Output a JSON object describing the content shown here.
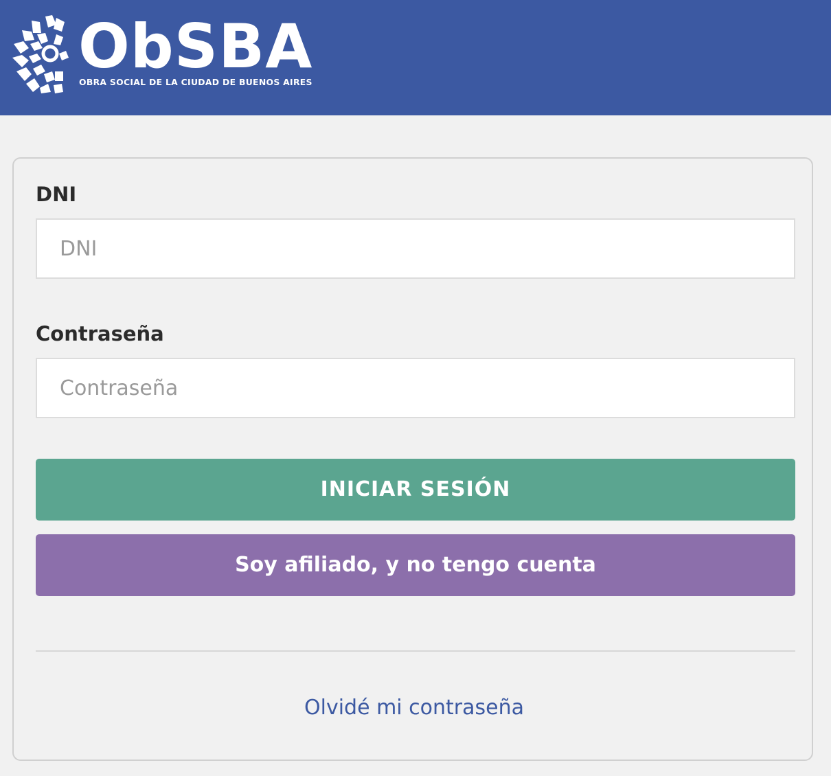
{
  "header": {
    "logo_text": "ObSBA",
    "tagline": "OBRA SOCIAL DE LA CIUDAD DE BUENOS AIRES",
    "background_color": "#3c59a2",
    "logo_icon": "flower-sun-icon"
  },
  "form": {
    "dni": {
      "label": "DNI",
      "placeholder": "DNI",
      "value": ""
    },
    "password": {
      "label": "Contraseña",
      "placeholder": "Contraseña",
      "value": ""
    },
    "login_button": {
      "label": "INICIAR SESIÓN",
      "color": "#5ba590"
    },
    "register_button": {
      "label": "Soy afiliado, y no tengo cuenta",
      "color": "#8c6fab"
    },
    "forgot_link": {
      "label": "Olvidé mi contraseña",
      "color": "#3c59a2"
    }
  },
  "colors": {
    "page_background": "#f1f1f1",
    "card_border": "#d0d0d0"
  }
}
